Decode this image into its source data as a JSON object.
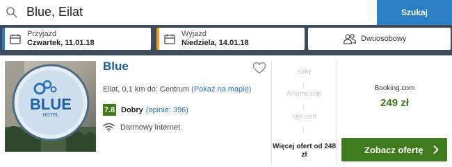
{
  "search": {
    "value": "Blue, Eilat",
    "button_label": "Szukaj"
  },
  "dates": {
    "checkin": {
      "label": "Przyjazd",
      "value": "Czwartek, 11.01.18"
    },
    "checkout": {
      "label": "Wyjazd",
      "value": "Niedziela, 14.01.18"
    }
  },
  "room": {
    "label": "Dwuosobowy"
  },
  "hotel": {
    "name": "Blue",
    "photo_sign": {
      "main": "BLUE",
      "sub": "HOTEL"
    },
    "location_text": "Eilat, 0,1 km do: Centrum",
    "map_link": "(Pokaż na mapie)",
    "score": "7.8",
    "rating_label": "Dobry",
    "reviews": "(opinie: 396)",
    "amenity": "Darmowy internet"
  },
  "offers": {
    "providers": [
      "eSky",
      "Amoma.com",
      "otel.com"
    ],
    "more_label": "Więcej ofert od 248 zł",
    "best_provider": "Booking.com",
    "best_price": "249 zł",
    "deal_button": "Zobacz ofertę"
  },
  "colors": {
    "accent_blue": "#2d7fc3",
    "checkout_orange": "#f19a21",
    "price_green": "#3e7a1a",
    "header_bg": "#37475a"
  },
  "icons": [
    "search-icon",
    "calendar-icon",
    "people-icon",
    "heart-icon",
    "wifi-icon",
    "chevron-right-icon"
  ]
}
